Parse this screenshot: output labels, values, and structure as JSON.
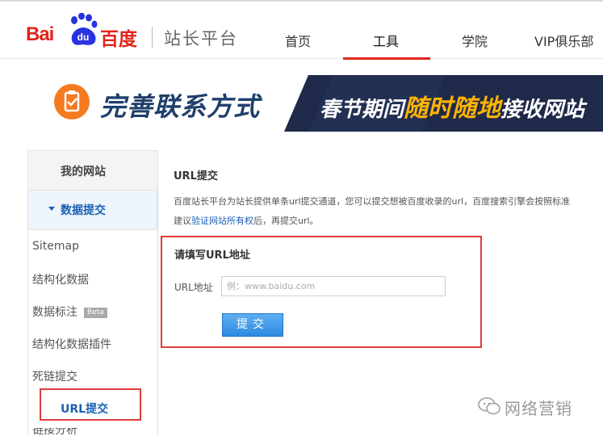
{
  "header": {
    "logo_text": "Bai",
    "logo_badge": "du",
    "logo_cn": "百度",
    "site_title": "站长平台",
    "nav": [
      {
        "label": "首页"
      },
      {
        "label": "工具"
      },
      {
        "label": "学院"
      },
      {
        "label": "VIP俱乐部"
      }
    ],
    "active_nav": "工具"
  },
  "banner": {
    "left_text": "完善联系方式",
    "right_text_a": "春节期间",
    "right_text_highlight": "随时随地",
    "right_text_b": "接收网站"
  },
  "sidebar": {
    "title": "我的网站",
    "group_label": "数据提交",
    "items": [
      {
        "label": "Sitemap"
      },
      {
        "label": "结构化数据"
      },
      {
        "label": "数据标注",
        "badge": "Beta"
      },
      {
        "label": "结构化数据插件"
      },
      {
        "label": "死链提交"
      },
      {
        "label": "URL提交"
      }
    ],
    "cut_item_label": "链接分析"
  },
  "main": {
    "title": "URL提交",
    "desc_line1": "百度站长平台为站长提供单条url提交通道，您可以提交想被百度收录的url，百度搜索引擎会按照标准",
    "desc_line2_prefix": "建议",
    "desc_link": "验证网站所有权",
    "desc_line2_suffix": "后，再提交url。",
    "form_title": "请填写URL地址",
    "url_label": "URL地址",
    "url_placeholder": "例：www.baidu.com",
    "submit_label": "提交"
  },
  "watermark": {
    "text": "网络营销"
  },
  "colors": {
    "brand_red": "#e1251b",
    "link_blue": "#1a5fb4",
    "highlight_border": "#e03b3b",
    "banner_orange": "#f47b20",
    "banner_navy": "#1f3f6b"
  }
}
